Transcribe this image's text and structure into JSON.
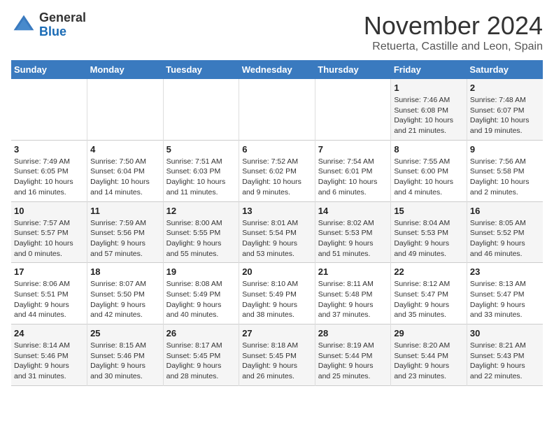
{
  "header": {
    "logo_line1": "General",
    "logo_line2": "Blue",
    "month_title": "November 2024",
    "subtitle": "Retuerta, Castille and Leon, Spain"
  },
  "weekdays": [
    "Sunday",
    "Monday",
    "Tuesday",
    "Wednesday",
    "Thursday",
    "Friday",
    "Saturday"
  ],
  "weeks": [
    [
      {
        "day": "",
        "info": ""
      },
      {
        "day": "",
        "info": ""
      },
      {
        "day": "",
        "info": ""
      },
      {
        "day": "",
        "info": ""
      },
      {
        "day": "",
        "info": ""
      },
      {
        "day": "1",
        "info": "Sunrise: 7:46 AM\nSunset: 6:08 PM\nDaylight: 10 hours\nand 21 minutes."
      },
      {
        "day": "2",
        "info": "Sunrise: 7:48 AM\nSunset: 6:07 PM\nDaylight: 10 hours\nand 19 minutes."
      }
    ],
    [
      {
        "day": "3",
        "info": "Sunrise: 7:49 AM\nSunset: 6:05 PM\nDaylight: 10 hours\nand 16 minutes."
      },
      {
        "day": "4",
        "info": "Sunrise: 7:50 AM\nSunset: 6:04 PM\nDaylight: 10 hours\nand 14 minutes."
      },
      {
        "day": "5",
        "info": "Sunrise: 7:51 AM\nSunset: 6:03 PM\nDaylight: 10 hours\nand 11 minutes."
      },
      {
        "day": "6",
        "info": "Sunrise: 7:52 AM\nSunset: 6:02 PM\nDaylight: 10 hours\nand 9 minutes."
      },
      {
        "day": "7",
        "info": "Sunrise: 7:54 AM\nSunset: 6:01 PM\nDaylight: 10 hours\nand 6 minutes."
      },
      {
        "day": "8",
        "info": "Sunrise: 7:55 AM\nSunset: 6:00 PM\nDaylight: 10 hours\nand 4 minutes."
      },
      {
        "day": "9",
        "info": "Sunrise: 7:56 AM\nSunset: 5:58 PM\nDaylight: 10 hours\nand 2 minutes."
      }
    ],
    [
      {
        "day": "10",
        "info": "Sunrise: 7:57 AM\nSunset: 5:57 PM\nDaylight: 10 hours\nand 0 minutes."
      },
      {
        "day": "11",
        "info": "Sunrise: 7:59 AM\nSunset: 5:56 PM\nDaylight: 9 hours\nand 57 minutes."
      },
      {
        "day": "12",
        "info": "Sunrise: 8:00 AM\nSunset: 5:55 PM\nDaylight: 9 hours\nand 55 minutes."
      },
      {
        "day": "13",
        "info": "Sunrise: 8:01 AM\nSunset: 5:54 PM\nDaylight: 9 hours\nand 53 minutes."
      },
      {
        "day": "14",
        "info": "Sunrise: 8:02 AM\nSunset: 5:53 PM\nDaylight: 9 hours\nand 51 minutes."
      },
      {
        "day": "15",
        "info": "Sunrise: 8:04 AM\nSunset: 5:53 PM\nDaylight: 9 hours\nand 49 minutes."
      },
      {
        "day": "16",
        "info": "Sunrise: 8:05 AM\nSunset: 5:52 PM\nDaylight: 9 hours\nand 46 minutes."
      }
    ],
    [
      {
        "day": "17",
        "info": "Sunrise: 8:06 AM\nSunset: 5:51 PM\nDaylight: 9 hours\nand 44 minutes."
      },
      {
        "day": "18",
        "info": "Sunrise: 8:07 AM\nSunset: 5:50 PM\nDaylight: 9 hours\nand 42 minutes."
      },
      {
        "day": "19",
        "info": "Sunrise: 8:08 AM\nSunset: 5:49 PM\nDaylight: 9 hours\nand 40 minutes."
      },
      {
        "day": "20",
        "info": "Sunrise: 8:10 AM\nSunset: 5:49 PM\nDaylight: 9 hours\nand 38 minutes."
      },
      {
        "day": "21",
        "info": "Sunrise: 8:11 AM\nSunset: 5:48 PM\nDaylight: 9 hours\nand 37 minutes."
      },
      {
        "day": "22",
        "info": "Sunrise: 8:12 AM\nSunset: 5:47 PM\nDaylight: 9 hours\nand 35 minutes."
      },
      {
        "day": "23",
        "info": "Sunrise: 8:13 AM\nSunset: 5:47 PM\nDaylight: 9 hours\nand 33 minutes."
      }
    ],
    [
      {
        "day": "24",
        "info": "Sunrise: 8:14 AM\nSunset: 5:46 PM\nDaylight: 9 hours\nand 31 minutes."
      },
      {
        "day": "25",
        "info": "Sunrise: 8:15 AM\nSunset: 5:46 PM\nDaylight: 9 hours\nand 30 minutes."
      },
      {
        "day": "26",
        "info": "Sunrise: 8:17 AM\nSunset: 5:45 PM\nDaylight: 9 hours\nand 28 minutes."
      },
      {
        "day": "27",
        "info": "Sunrise: 8:18 AM\nSunset: 5:45 PM\nDaylight: 9 hours\nand 26 minutes."
      },
      {
        "day": "28",
        "info": "Sunrise: 8:19 AM\nSunset: 5:44 PM\nDaylight: 9 hours\nand 25 minutes."
      },
      {
        "day": "29",
        "info": "Sunrise: 8:20 AM\nSunset: 5:44 PM\nDaylight: 9 hours\nand 23 minutes."
      },
      {
        "day": "30",
        "info": "Sunrise: 8:21 AM\nSunset: 5:43 PM\nDaylight: 9 hours\nand 22 minutes."
      }
    ]
  ]
}
